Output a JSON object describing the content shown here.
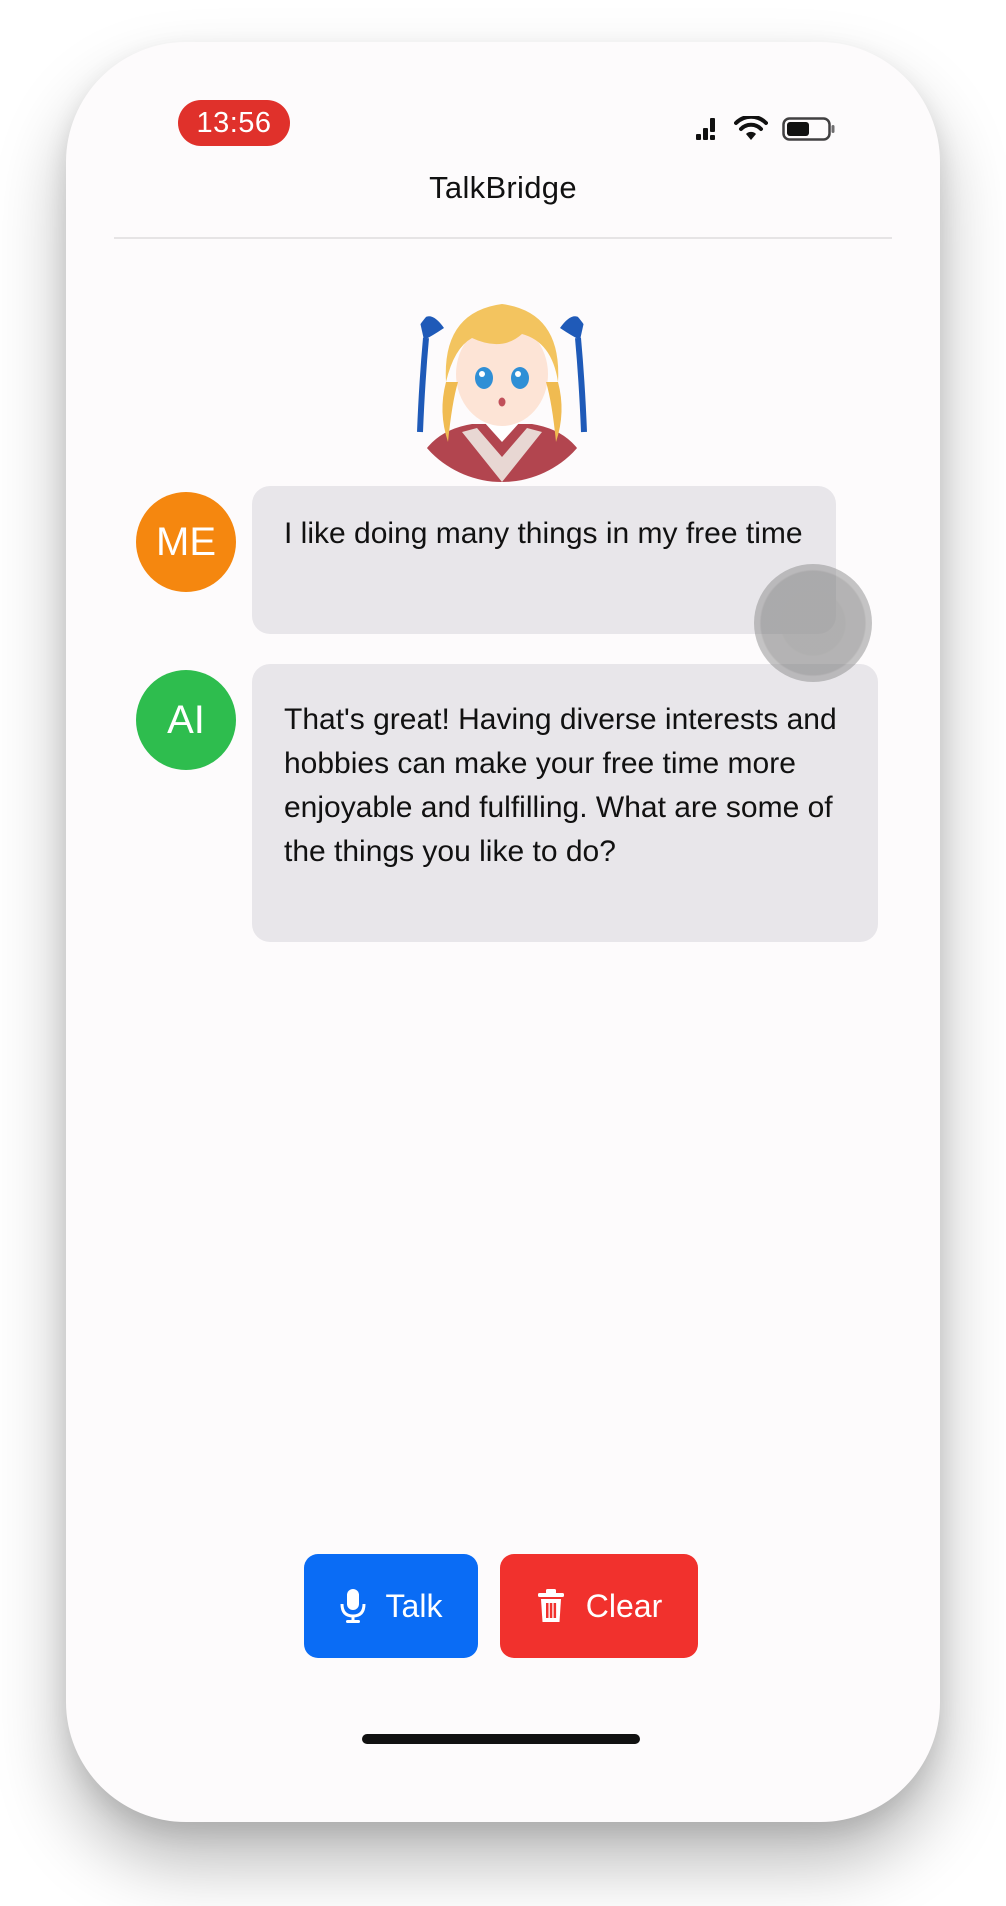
{
  "status_bar": {
    "time": "13:56"
  },
  "nav": {
    "title": "TalkBridge"
  },
  "character": {
    "avatar_alt": "anime-girl-avatar"
  },
  "messages": [
    {
      "sender_label": "ME",
      "sender_color": "#f5870f",
      "text": "I like doing many things in my free time"
    },
    {
      "sender_label": "AI",
      "sender_color": "#2ebd4e",
      "text": "That's great! Having diverse interests and hobbies can make your free time more enjoyable and fulfilling. What are some of the things you like to do?"
    }
  ],
  "actions": {
    "talk_label": "Talk",
    "talk_icon": "microphone-icon",
    "talk_color": "#0a6cf5",
    "clear_label": "Clear",
    "clear_icon": "trash-icon",
    "clear_color": "#f1312d"
  }
}
